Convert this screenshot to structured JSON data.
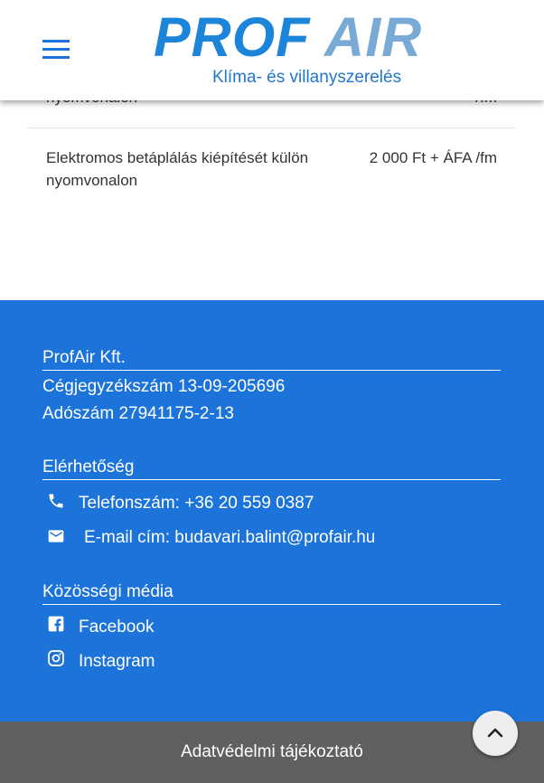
{
  "header": {
    "logo_word_1": "PROF",
    "logo_word_2": "AIR",
    "tagline": "Klíma- és villanyszerelés",
    "menu_icon": "hamburger-menu-icon"
  },
  "price_table": {
    "rows": [
      {
        "description": "nyomvonalon",
        "price": "/fm"
      },
      {
        "description": "Elektromos betáplálás kiépítését külön nyomvonalon",
        "price": "2 000 Ft + ÁFA /fm"
      }
    ]
  },
  "footer": {
    "company": {
      "heading": "ProfAir Kft.",
      "registration": "Cégjegyzékszám 13-09-205696",
      "tax_number": "Adószám 27941175-2-13"
    },
    "contact": {
      "heading": "Elérhetőség",
      "phone": "Telefonszám: +36 20 559 0387",
      "email": "E-mail cím: budavari.balint@profair.hu",
      "phone_icon": "phone-icon",
      "email_icon": "mail-icon"
    },
    "social": {
      "heading": "Közösségi média",
      "facebook": "Facebook",
      "instagram": "Instagram",
      "facebook_icon": "facebook-icon",
      "instagram_icon": "instagram-icon"
    }
  },
  "bottom_bar": {
    "privacy_link": "Adatvédelmi tájékoztató",
    "scroll_top_icon": "chevron-up-icon"
  },
  "colors": {
    "brand_blue": "#1c73d9",
    "logo_light_blue": "#79aad6",
    "bottom_bar_gray": "#606060"
  }
}
